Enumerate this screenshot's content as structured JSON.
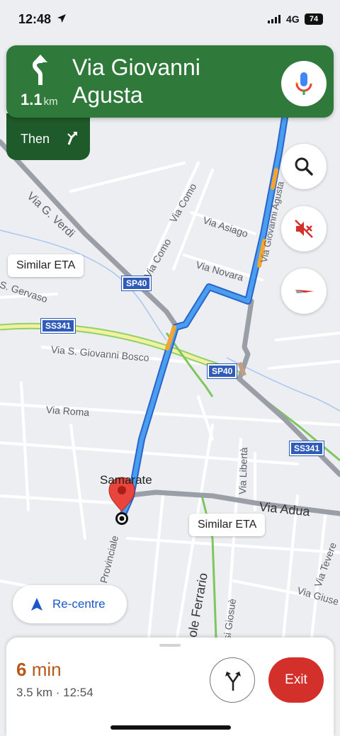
{
  "status_bar": {
    "time": "12:48",
    "network": "4G",
    "battery": "74"
  },
  "navigation": {
    "distance_value": "1.1",
    "distance_unit": "km",
    "street_line1": "Via Giovanni",
    "street_line2": "Agusta",
    "then_label": "Then"
  },
  "map": {
    "callout_top": "Similar ETA",
    "callout_bottom": "Similar ETA",
    "town": "Samarate",
    "shields": [
      "SP40",
      "SS341",
      "SP40",
      "SS341"
    ],
    "streets": [
      "Via G. Verdi",
      "Via Como",
      "Via Como",
      "Via Asiago",
      "Via Novara",
      "S. Gervaso",
      "Via S. Giovanni Bosco",
      "Via Roma",
      "Via Libertà",
      "Via Adua",
      "Via Provinciale",
      "Via Giovanni Agusta",
      "Via Tevere",
      "Via Giuse",
      "sole Ferrario",
      "si Giosuè"
    ],
    "recentre_label": "Re-centre"
  },
  "trip": {
    "duration": "6",
    "duration_unit": "min",
    "summary": "3.5 km · 12:54",
    "exit_label": "Exit"
  },
  "colors": {
    "banner": "#2f7a3a",
    "route": "#4a8ee8",
    "exit": "#d3302b"
  }
}
